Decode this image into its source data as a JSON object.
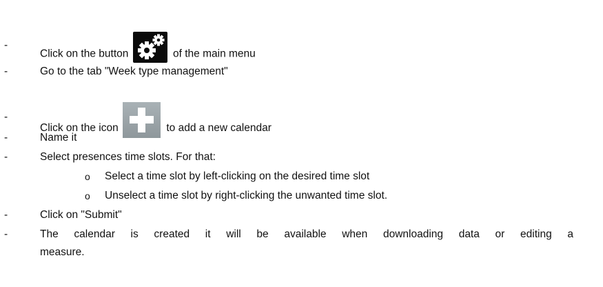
{
  "steps": [
    {
      "bullet": "-",
      "text_before": "Click on the button",
      "icon": "gear-icon",
      "text_after": "of the main menu"
    },
    {
      "bullet": "-",
      "text": "Go to the tab \"Week type management\""
    },
    {
      "bullet": "-",
      "text_before": "Click on the icon",
      "icon": "plus-icon",
      "text_after": "to add a new calendar"
    },
    {
      "bullet": "-",
      "text": "Name it"
    },
    {
      "bullet": "-",
      "text": "Select presences time slots. For that:"
    },
    {
      "bullet": "o",
      "text": "Select a time slot by left-clicking on the desired time slot"
    },
    {
      "bullet": "o",
      "text": "Unselect a time slot by right-clicking the unwanted time slot."
    },
    {
      "bullet": "-",
      "text": "Click on \"Submit\""
    },
    {
      "bullet": "-",
      "text_line1": "The calendar is created it will be available when downloading data or editing a",
      "text_line2": "measure."
    }
  ]
}
